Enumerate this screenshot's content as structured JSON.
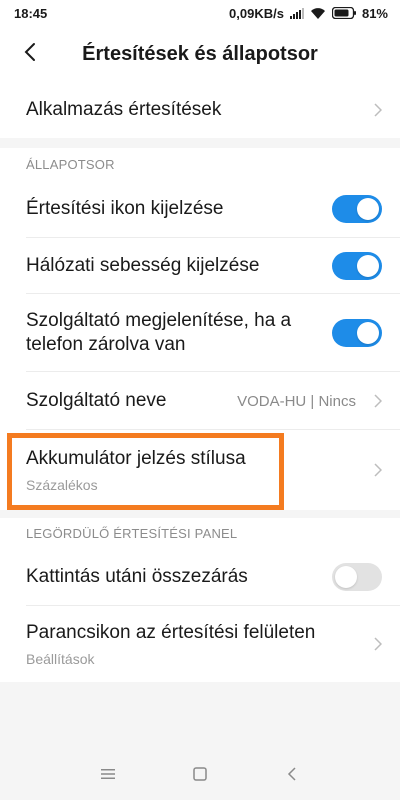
{
  "status_bar": {
    "time": "18:45",
    "speed": "0,09KB/s",
    "battery": "81%"
  },
  "header": {
    "title": "Értesítések és állapotsor"
  },
  "app_notifications": {
    "label": "Alkalmazás értesítések"
  },
  "status_section": {
    "header": "ÁLLAPOTSOR",
    "items": [
      {
        "label": "Értesítési ikon kijelzése",
        "enabled": true
      },
      {
        "label": "Hálózati sebesség kijelzése",
        "enabled": true
      },
      {
        "label": "Szolgáltató megjelenítése, ha a telefon zárolva van",
        "enabled": true
      }
    ],
    "carrier": {
      "label": "Szolgáltató neve",
      "value": "VODA-HU | Nincs"
    },
    "battery_style": {
      "label": "Akkumulátor jelzés stílusa",
      "value": "Százalékos"
    }
  },
  "pulldown_section": {
    "header": "LEGÖRDÜLŐ ÉRTESÍTÉSI PANEL",
    "close_after_tap": {
      "label": "Kattintás utáni összezárás",
      "enabled": false
    },
    "shortcuts": {
      "label": "Parancsikon az értesítési felületen",
      "sub": "Beállítások"
    }
  },
  "colors": {
    "accent": "#1e8ce8",
    "highlight": "#f47b20"
  }
}
